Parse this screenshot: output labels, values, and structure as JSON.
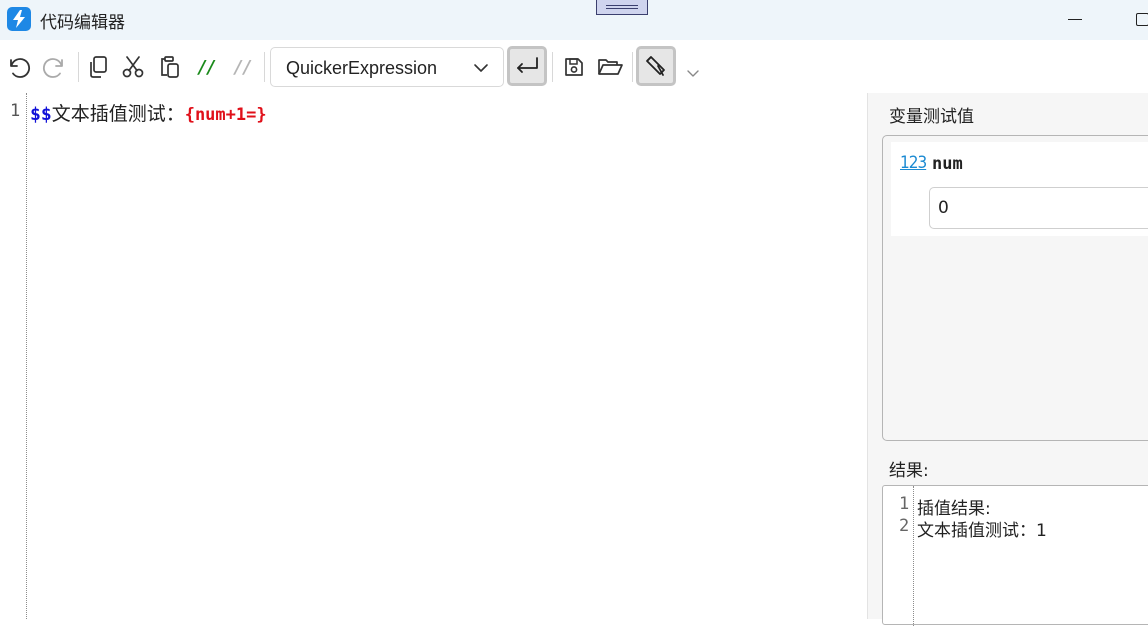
{
  "window": {
    "title": "代码编辑器",
    "app_icon": "quicker-bolt-icon",
    "accent_color": "#1e88e5"
  },
  "toolbar": {
    "buttons": [
      "undo-icon",
      "redo-icon",
      "copy-icon",
      "cut-icon",
      "paste-icon",
      "comment-icon",
      "uncomment-icon",
      "word-wrap-icon",
      "save-icon",
      "open-folder-icon",
      "highlight-icon",
      "overflow-chevron-icon"
    ],
    "comment_label": "//",
    "uncomment_label": "//",
    "language_selected": "QuickerExpression"
  },
  "editor": {
    "line_numbers": [
      "1"
    ],
    "code": {
      "prefix": "$$",
      "text": "文本插值测试：",
      "expression": "{num+1=}"
    },
    "colors": {
      "prefix": "#1010d8",
      "expression": "#e0101a"
    }
  },
  "side_panel": {
    "variables_label": "变量测试值",
    "variable": {
      "type": "123",
      "name": "num",
      "value": "0"
    },
    "result_label": "结果:",
    "result_lines": [
      {
        "no": "1",
        "text": "插值结果:"
      },
      {
        "no": "2",
        "text": "文本插值测试：1"
      }
    ]
  }
}
